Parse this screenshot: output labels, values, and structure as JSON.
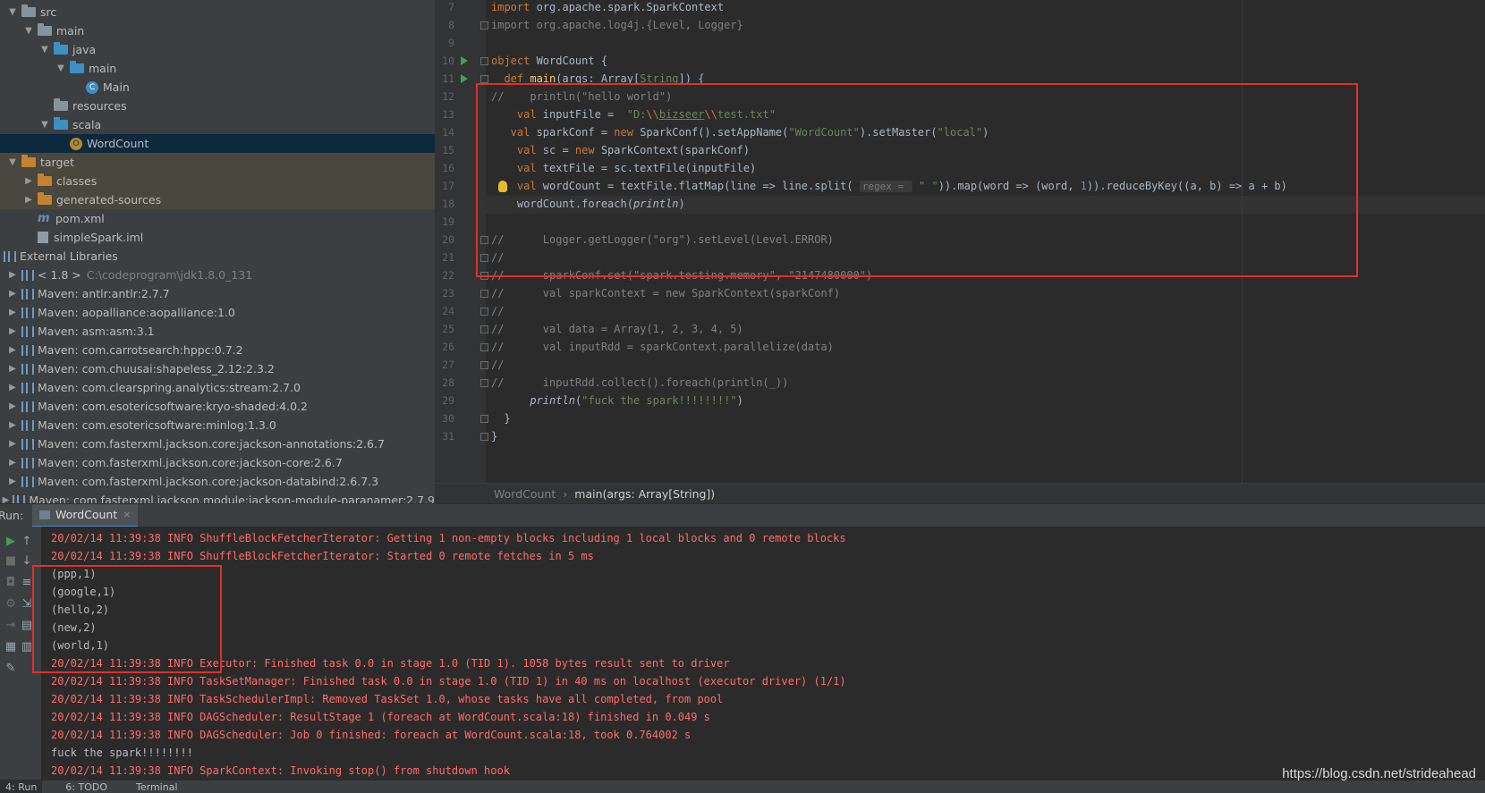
{
  "project_tree": [
    {
      "depth": 0,
      "expanded": true,
      "icon": "folder-icon",
      "label": "src"
    },
    {
      "depth": 1,
      "expanded": true,
      "icon": "folder-icon",
      "label": "main"
    },
    {
      "depth": 2,
      "expanded": true,
      "icon": "folder-blue-icon",
      "label": "java"
    },
    {
      "depth": 3,
      "expanded": true,
      "icon": "package-icon",
      "label": "main"
    },
    {
      "depth": 4,
      "expanded": null,
      "icon": "class-icon",
      "label": "Main"
    },
    {
      "depth": 2,
      "expanded": null,
      "icon": "resources-folder-icon",
      "label": "resources"
    },
    {
      "depth": 2,
      "expanded": true,
      "icon": "folder-blue-icon",
      "label": "scala"
    },
    {
      "depth": 3,
      "expanded": null,
      "icon": "scala-object-icon",
      "label": "WordCount",
      "selected": true
    },
    {
      "depth": 0,
      "expanded": true,
      "icon": "folder-orange-icon",
      "label": "target",
      "excluded": true
    },
    {
      "depth": 1,
      "expanded": false,
      "icon": "folder-orange-icon",
      "label": "classes",
      "excluded": true
    },
    {
      "depth": 1,
      "expanded": false,
      "icon": "folder-orange-icon",
      "label": "generated-sources",
      "excluded": true
    },
    {
      "depth": 1,
      "expanded": null,
      "icon": "maven-icon",
      "label": "pom.xml"
    },
    {
      "depth": 1,
      "expanded": null,
      "icon": "iml-file-icon",
      "label": "simpleSpark.iml"
    },
    {
      "depth": -1,
      "expanded": null,
      "icon": "library-icon",
      "label": "External Libraries"
    },
    {
      "depth": 0,
      "expanded": false,
      "icon": "jdk-icon",
      "label": "< 1.8 >",
      "extra": "C:\\codeprogram\\jdk1.8.0_131"
    },
    {
      "depth": 0,
      "expanded": false,
      "icon": "library-icon",
      "label": "Maven: antlr:antlr:2.7.7"
    },
    {
      "depth": 0,
      "expanded": false,
      "icon": "library-icon",
      "label": "Maven: aopalliance:aopalliance:1.0"
    },
    {
      "depth": 0,
      "expanded": false,
      "icon": "library-icon",
      "label": "Maven: asm:asm:3.1"
    },
    {
      "depth": 0,
      "expanded": false,
      "icon": "library-icon",
      "label": "Maven: com.carrotsearch:hppc:0.7.2"
    },
    {
      "depth": 0,
      "expanded": false,
      "icon": "library-icon",
      "label": "Maven: com.chuusai:shapeless_2.12:2.3.2"
    },
    {
      "depth": 0,
      "expanded": false,
      "icon": "library-icon",
      "label": "Maven: com.clearspring.analytics:stream:2.7.0"
    },
    {
      "depth": 0,
      "expanded": false,
      "icon": "library-icon",
      "label": "Maven: com.esotericsoftware:kryo-shaded:4.0.2"
    },
    {
      "depth": 0,
      "expanded": false,
      "icon": "library-icon",
      "label": "Maven: com.esotericsoftware:minlog:1.3.0"
    },
    {
      "depth": 0,
      "expanded": false,
      "icon": "library-icon",
      "label": "Maven: com.fasterxml.jackson.core:jackson-annotations:2.6.7"
    },
    {
      "depth": 0,
      "expanded": false,
      "icon": "library-icon",
      "label": "Maven: com.fasterxml.jackson.core:jackson-core:2.6.7"
    },
    {
      "depth": 0,
      "expanded": false,
      "icon": "library-icon",
      "label": "Maven: com.fasterxml.jackson.core:jackson-databind:2.6.7.3"
    },
    {
      "depth": 0,
      "expanded": false,
      "icon": "library-icon",
      "label": "Maven: com.fasterxml.jackson.module:jackson-module-paranamer:2.7.9"
    }
  ],
  "editor": {
    "line_numbers": [
      "7",
      "8",
      "9",
      "10",
      "11",
      "12",
      "13",
      "14",
      "15",
      "16",
      "17",
      "18",
      "19",
      "20",
      "21",
      "22",
      "23",
      "24",
      "25",
      "26",
      "27",
      "28",
      "29",
      "30",
      "31"
    ],
    "lines": [
      [
        {
          "t": "import ",
          "c": "kw"
        },
        {
          "t": "org.apache.spark.SparkContext",
          "c": ""
        }
      ],
      [
        {
          "t": "import org.apache.log4j.{Level, Logger}",
          "c": "cm"
        }
      ],
      [],
      [
        {
          "t": "object ",
          "c": "kw"
        },
        {
          "t": "WordCount {",
          "c": ""
        }
      ],
      [
        {
          "t": "  def ",
          "c": "kw"
        },
        {
          "t": "main",
          "c": "fn"
        },
        {
          "t": "(args: Array[",
          "c": ""
        },
        {
          "t": "String",
          "c": "str"
        },
        {
          "t": "]) {",
          "c": ""
        }
      ],
      [
        {
          "t": "//    println(\"hello world\")",
          "c": "cm"
        }
      ],
      [
        {
          "t": "    val ",
          "c": "kw"
        },
        {
          "t": "inputFile =  ",
          "c": ""
        },
        {
          "t": "\"D:",
          "c": "str"
        },
        {
          "t": "\\\\",
          "c": "kw"
        },
        {
          "t": "bizseer",
          "c": "str und"
        },
        {
          "t": "\\\\",
          "c": "kw"
        },
        {
          "t": "test.txt\"",
          "c": "str"
        }
      ],
      [
        {
          "t": "   val ",
          "c": "kw"
        },
        {
          "t": "sparkConf = ",
          "c": ""
        },
        {
          "t": "new ",
          "c": "kw"
        },
        {
          "t": "SparkConf().setAppName(",
          "c": ""
        },
        {
          "t": "\"WordCount\"",
          "c": "str"
        },
        {
          "t": ").setMaster(",
          "c": ""
        },
        {
          "t": "\"local\"",
          "c": "str"
        },
        {
          "t": ")",
          "c": ""
        }
      ],
      [
        {
          "t": "    val ",
          "c": "kw"
        },
        {
          "t": "sc = ",
          "c": ""
        },
        {
          "t": "new ",
          "c": "kw"
        },
        {
          "t": "SparkContext(sparkConf)",
          "c": ""
        }
      ],
      [
        {
          "t": "    val ",
          "c": "kw"
        },
        {
          "t": "textFile = sc.textFile(inputFile)",
          "c": ""
        }
      ],
      [
        {
          "t": "    val ",
          "c": "kw"
        },
        {
          "t": "wordCount = textFile.flatMap(line => line.split( ",
          "c": ""
        },
        {
          "t": "regex = ",
          "c": "hint"
        },
        {
          "t": " \" \"",
          "c": "str"
        },
        {
          "t": ")).map(word => (word, ",
          "c": ""
        },
        {
          "t": "1",
          "c": "num"
        },
        {
          "t": ")).reduceByKey((a, b) => a + b)",
          "c": ""
        }
      ],
      [
        {
          "t": "    wordCount.foreach(",
          "c": ""
        },
        {
          "t": "println",
          "c": "it"
        },
        {
          "t": ")",
          "c": ""
        }
      ],
      [],
      [
        {
          "t": "//      Logger.getLogger(\"org\").setLevel(Level.ERROR)",
          "c": "cm"
        }
      ],
      [
        {
          "t": "//",
          "c": "cm"
        }
      ],
      [
        {
          "t": "//      sparkConf.set(\"spark.testing.memory\", \"2147480000\")",
          "c": "cm"
        }
      ],
      [
        {
          "t": "//      val sparkContext = new SparkContext(sparkConf)",
          "c": "cm"
        }
      ],
      [
        {
          "t": "//",
          "c": "cm"
        }
      ],
      [
        {
          "t": "//      val data = Array(1, 2, 3, 4, 5)",
          "c": "cm"
        }
      ],
      [
        {
          "t": "//      val inputRdd = sparkContext.parallelize(data)",
          "c": "cm"
        }
      ],
      [
        {
          "t": "//",
          "c": "cm"
        }
      ],
      [
        {
          "t": "//      inputRdd.collect().foreach(println(_))",
          "c": "cm"
        }
      ],
      [
        {
          "t": "      ",
          "c": ""
        },
        {
          "t": "println",
          "c": "it"
        },
        {
          "t": "(",
          "c": ""
        },
        {
          "t": "\"fuck the spark!!!!!!!!\"",
          "c": "str"
        },
        {
          "t": ")",
          "c": ""
        }
      ],
      [
        {
          "t": "  }",
          "c": ""
        }
      ],
      [
        {
          "t": "}",
          "c": ""
        }
      ]
    ]
  },
  "breadcrumb": {
    "item1": "WordCount",
    "separator": "›",
    "item2": "main(args: Array[String])"
  },
  "run_panel": {
    "label": "Run:",
    "tab": "WordCount",
    "close": "×",
    "toolbar_icons": [
      "rerun-icon",
      "up-icon",
      "stop-icon",
      "down-icon",
      "camera-icon",
      "wrap-icon",
      "settings-icon",
      "scroll-end-icon",
      "login-icon",
      "print-icon",
      "layout-icon",
      "trash-icon",
      "pin-icon"
    ],
    "output": [
      {
        "t": "20/02/14 11:39:38 INFO ShuffleBlockFetcherIterator: Getting 1 non-empty blocks including 1 local blocks and 0 remote blocks",
        "c": "info"
      },
      {
        "t": "20/02/14 11:39:38 INFO ShuffleBlockFetcherIterator: Started 0 remote fetches in 5 ms",
        "c": "info"
      },
      {
        "t": "(ppp,1)",
        "c": "plain"
      },
      {
        "t": "(google,1)",
        "c": "plain"
      },
      {
        "t": "(hello,2)",
        "c": "plain"
      },
      {
        "t": "(new,2)",
        "c": "plain"
      },
      {
        "t": "(world,1)",
        "c": "plain"
      },
      {
        "t": "20/02/14 11:39:38 INFO Executor: Finished task 0.0 in stage 1.0 (TID 1). 1058 bytes result sent to driver",
        "c": "info"
      },
      {
        "t": "20/02/14 11:39:38 INFO TaskSetManager: Finished task 0.0 in stage 1.0 (TID 1) in 40 ms on localhost (executor driver) (1/1)",
        "c": "info"
      },
      {
        "t": "20/02/14 11:39:38 INFO TaskSchedulerImpl: Removed TaskSet 1.0, whose tasks have all completed, from pool",
        "c": "info"
      },
      {
        "t": "20/02/14 11:39:38 INFO DAGScheduler: ResultStage 1 (foreach at WordCount.scala:18) finished in 0.049 s",
        "c": "info"
      },
      {
        "t": "20/02/14 11:39:38 INFO DAGScheduler: Job 0 finished: foreach at WordCount.scala:18, took 0.764002 s",
        "c": "info"
      },
      {
        "t": "fuck the spark!!!!!!!!",
        "c": "plain"
      },
      {
        "t": "20/02/14 11:39:38 INFO SparkContext: Invoking stop() from shutdown hook",
        "c": "info"
      }
    ]
  },
  "bottom_tabs": [
    "4: Run",
    "6: TODO",
    "Terminal"
  ],
  "watermark": "https://blog.csdn.net/strideahead",
  "colors": {
    "highlight_box": "#e0302a",
    "info_text": "#ff6b68",
    "selection": "#0d293e"
  }
}
